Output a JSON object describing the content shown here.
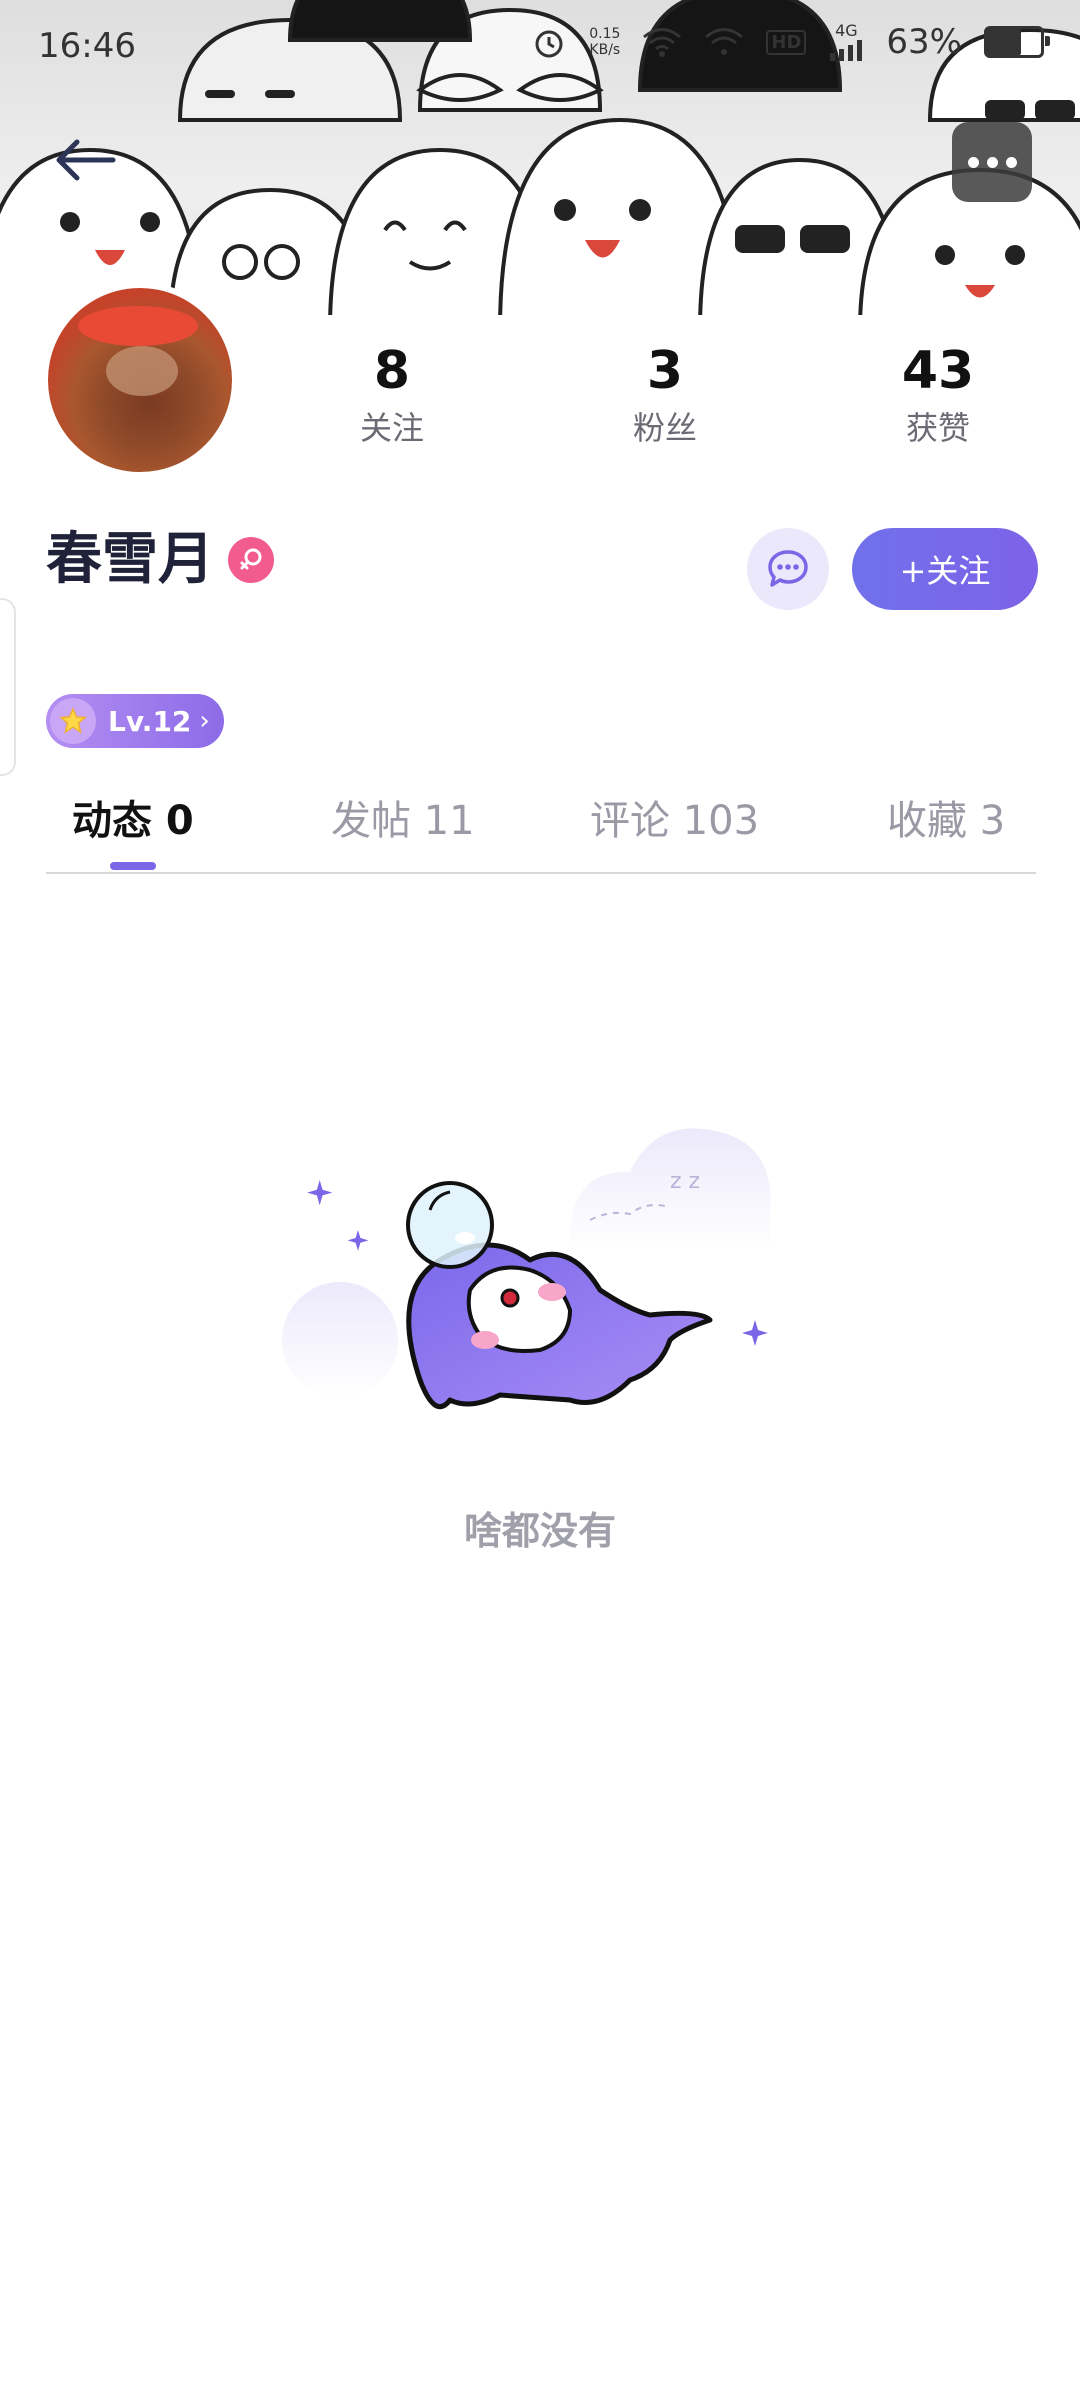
{
  "status_bar": {
    "time": "16:46",
    "net_speed_value": "0.15",
    "net_speed_unit": "KB/s",
    "hd_label": "HD",
    "cell_label": "4G",
    "battery_percent": "63%",
    "battery_level": 0.63
  },
  "profile": {
    "username": "春雪月",
    "gender": "female",
    "level": "Lv.12"
  },
  "stats": [
    {
      "value": "8",
      "label": "关注"
    },
    {
      "value": "3",
      "label": "粉丝"
    },
    {
      "value": "43",
      "label": "获赞"
    }
  ],
  "actions": {
    "follow_label": "+关注"
  },
  "tabs": [
    {
      "label": "动态 0",
      "active": true
    },
    {
      "label": "发帖 11",
      "active": false
    },
    {
      "label": "评论 103",
      "active": false
    },
    {
      "label": "收藏 3",
      "active": false
    }
  ],
  "empty_state": {
    "text": "啥都没有"
  },
  "colors": {
    "accent": "#7a66e6",
    "follow_gradient_start": "#7071ea",
    "follow_gradient_end": "#7e62e8",
    "gender_badge": "#f25b8e"
  }
}
